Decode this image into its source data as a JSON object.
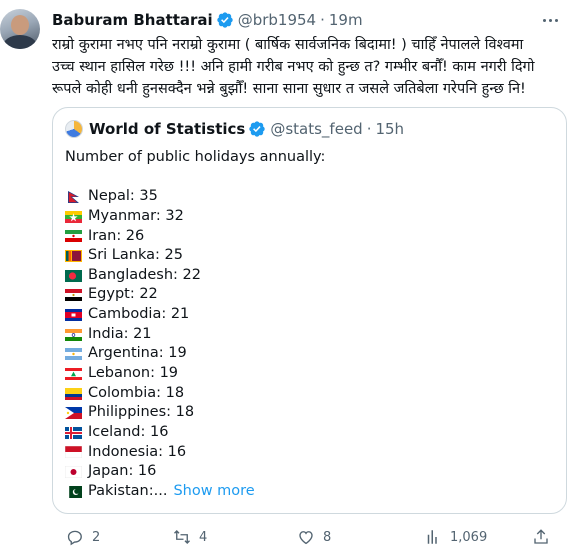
{
  "author": {
    "name": "Baburam Bhattarai",
    "handle": "@brb1954",
    "separator": "·",
    "time": "19m",
    "avatar_icon": "user-avatar"
  },
  "tweet_lines": [
    "राम्रो कुरामा नभए पनि नराम्रो कुरामा ( बार्षिक सार्वजनिक बिदामा! ) चाहिँ नेपालले विश्वमा",
    "उच्च स्थान हासिल गरेछ !!! अनि हामी गरीब नभए को हुन्छ त? गम्भीर बनौँ! काम नगरी दिगो",
    "रूपले कोही धनी हुनसक्दैन भन्ने बुझौँ! साना साना सुधार त जसले जतिबेला गरेपनि हुन्छ नि!"
  ],
  "quote": {
    "name": "World of Statistics",
    "handle": "@stats_feed",
    "separator": "·",
    "time": "15h",
    "intro": "Number of public holidays annually:",
    "countries": [
      "Nepal: 35",
      "Myanmar: 32",
      "Iran: 26",
      "Sri Lanka: 25",
      "Bangladesh: 22",
      "Egypt: 22",
      "Cambodia: 21",
      "India: 21",
      "Argentina: 19",
      "Lebanon: 19",
      "Colombia: 18",
      "Philippines: 18",
      "Iceland: 16",
      "Indonesia: 16",
      "Japan: 16",
      "Pakistan:..."
    ],
    "show_more": "Show more"
  },
  "actions": {
    "replies": "2",
    "retweets": "4",
    "likes": "8",
    "views": "1,069"
  },
  "colors": {
    "accent": "#1d9bf0",
    "secondary_text": "#536471",
    "border": "#cfd9de"
  }
}
